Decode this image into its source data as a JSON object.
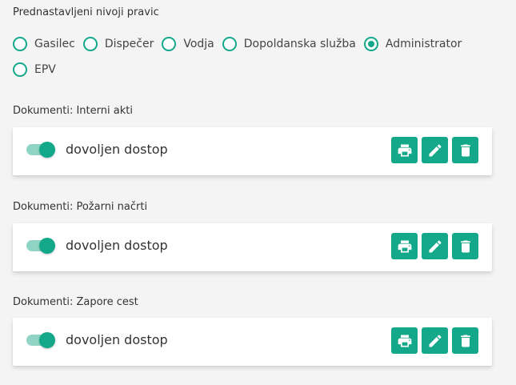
{
  "permissions": {
    "title": "Prednastavljeni nivoji pravic",
    "options": [
      {
        "label": "Gasilec",
        "checked": false
      },
      {
        "label": "Dispečer",
        "checked": false
      },
      {
        "label": "Vodja",
        "checked": false
      },
      {
        "label": "Dopoldanska služba",
        "checked": false
      },
      {
        "label": "Administrator",
        "checked": true
      },
      {
        "label": "EPV",
        "checked": false
      }
    ]
  },
  "documents": [
    {
      "label": "Dokumenti: Interni akti",
      "toggle_label": "dovoljen dostop",
      "enabled": true
    },
    {
      "label": "Dokumenti: Požarni načrti",
      "toggle_label": "dovoljen dostop",
      "enabled": true
    },
    {
      "label": "Dokumenti: Zapore cest",
      "toggle_label": "dovoljen dostop",
      "enabled": true
    }
  ],
  "actions": {
    "icons": [
      "print-icon",
      "edit-icon",
      "delete-icon"
    ]
  },
  "colors": {
    "accent": "#14a88a",
    "toggle_track": "#8fd4c4",
    "background": "#f4f4f4"
  }
}
